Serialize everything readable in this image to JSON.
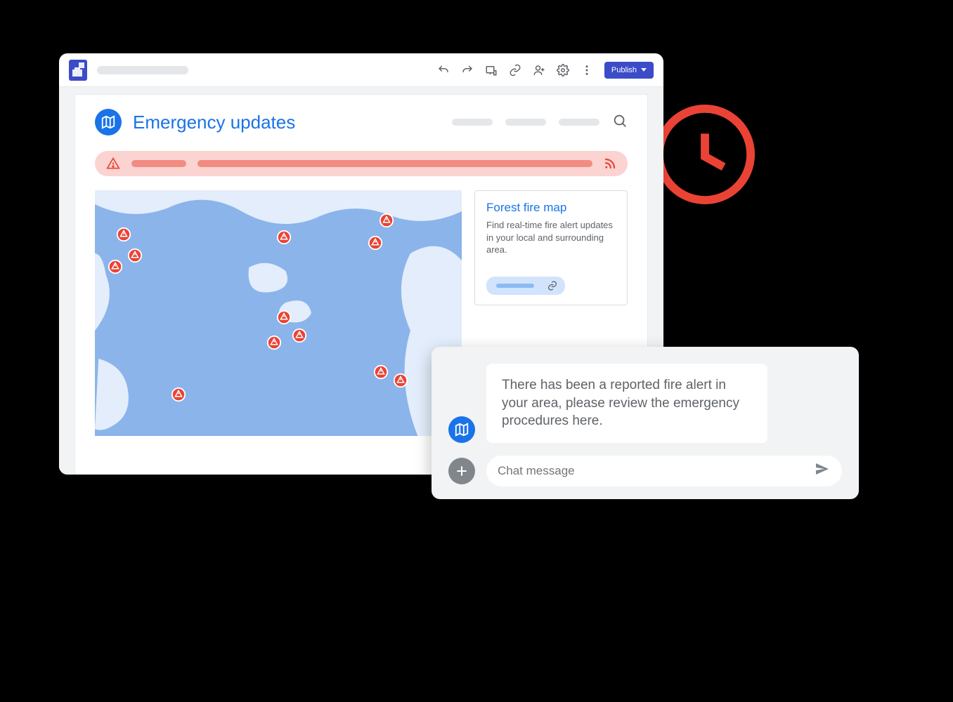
{
  "chrome": {
    "publish_label": "Publish"
  },
  "site": {
    "title": "Emergency updates"
  },
  "info_card": {
    "title": "Forest fire map",
    "body": "Find real-time fire alert updates in your local and surrounding area."
  },
  "chat": {
    "message": "There has been a reported fire alert in your area, please review the emergency procedures here.",
    "input_placeholder": "Chat message"
  },
  "colors": {
    "accent_blue": "#1a73e8",
    "brand_indigo": "#3c4bc8",
    "alert_red": "#ea4335",
    "alert_bg": "#fbd3d1"
  }
}
